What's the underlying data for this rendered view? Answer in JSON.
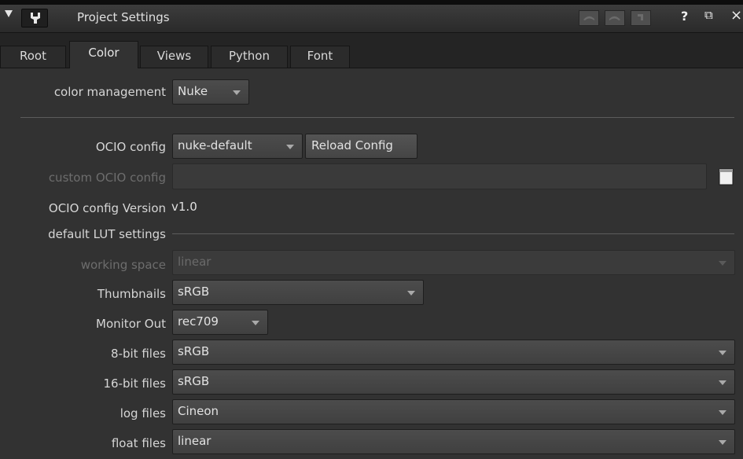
{
  "window": {
    "title": "Project Settings"
  },
  "tabs": [
    {
      "label": "Root"
    },
    {
      "label": "Color"
    },
    {
      "label": "Views"
    },
    {
      "label": "Python"
    },
    {
      "label": "Font"
    }
  ],
  "color_management": {
    "label": "color management",
    "value": "Nuke"
  },
  "ocio": {
    "config_label": "OCIO config",
    "config_value": "nuke-default",
    "reload_label": "Reload Config",
    "custom_label": "custom OCIO config",
    "custom_value": "",
    "version_label": "OCIO config Version",
    "version_value": "v1.0"
  },
  "lut": {
    "section_label": "default LUT settings",
    "rows": [
      {
        "label": "working space",
        "value": "linear"
      },
      {
        "label": "Thumbnails",
        "value": "sRGB"
      },
      {
        "label": "Monitor Out",
        "value": "rec709"
      },
      {
        "label": "8-bit files",
        "value": "sRGB"
      },
      {
        "label": "16-bit files",
        "value": "sRGB"
      },
      {
        "label": "log files",
        "value": "Cineon"
      },
      {
        "label": "float files",
        "value": "linear"
      }
    ]
  },
  "icons": {
    "collapse": "triangle-down-icon",
    "panel": "wrench-icon",
    "undo": "undo-icon",
    "redo": "redo-icon",
    "revert": "revert-icon",
    "help": "help-icon",
    "float": "float-window-icon",
    "close": "close-icon",
    "folder": "folder-icon"
  },
  "colors": {
    "background": "#323232",
    "titlebar": "#2a2a2a",
    "tabbar": "#242424",
    "text": "#d6d6d6",
    "disabled_text": "#6d6d6d"
  }
}
